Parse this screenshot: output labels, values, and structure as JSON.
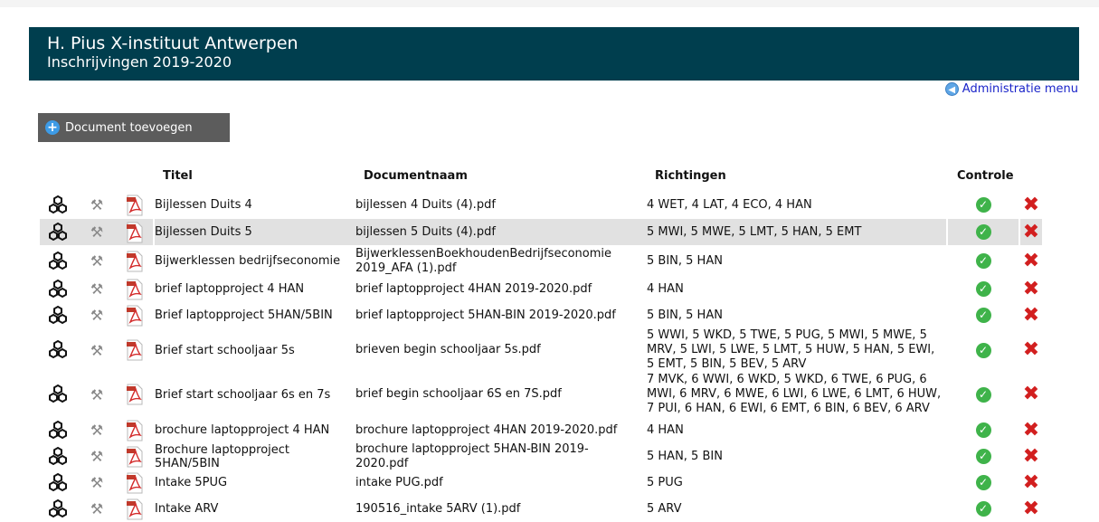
{
  "header": {
    "title": "H. Pius X-instituut Antwerpen",
    "subtitle": "Inschrijvingen 2019-2020"
  },
  "admin_link": "Administratie menu",
  "add_button": "Document toevoegen",
  "columns": {
    "titel": "Titel",
    "documentnaam": "Documentnaam",
    "richtingen": "Richtingen",
    "controle": "Controle"
  },
  "icons": {
    "group": "hexagon-group-icon",
    "tools": "tools-icon",
    "pdf": "pdf-file-icon",
    "ok": "check-circle-icon",
    "delete": "delete-x-icon"
  },
  "colors": {
    "header_bg": "#003e4e",
    "button_bg": "#5c5c5c",
    "highlight_row": "#e1e1e1",
    "check_green": "#3fb34a",
    "delete_red": "#d21f1f"
  },
  "rows": [
    {
      "titel": "Bijlessen Duits 4",
      "doc": "bijlessen 4 Duits (4).pdf",
      "rich": "4 WET, 4 LAT, 4 ECO, 4 HAN"
    },
    {
      "titel": "Bijlessen Duits 5",
      "doc": "bijlessen 5 Duits (4).pdf",
      "rich": "5 MWI, 5 MWE, 5 LMT, 5 HAN, 5 EMT"
    },
    {
      "titel": "Bijwerklessen bedrijfseconomie",
      "doc": "BijwerklessenBoekhoudenBedrijfseconomie 2019_AFA (1).pdf",
      "rich": "5 BIN, 5 HAN"
    },
    {
      "titel": "brief laptopproject 4 HAN",
      "doc": "brief laptopproject 4HAN 2019-2020.pdf",
      "rich": "4 HAN"
    },
    {
      "titel": "Brief laptopproject 5HAN/5BIN",
      "doc": "brief laptopproject 5HAN-BIN 2019-2020.pdf",
      "rich": "5 BIN, 5 HAN"
    },
    {
      "titel": "Brief start schooljaar 5s",
      "doc": "brieven begin schooljaar 5s.pdf",
      "rich": "5 WWI, 5 WKD, 5 TWE, 5 PUG, 5 MWI, 5 MWE, 5 MRV, 5 LWI, 5 LWE, 5 LMT, 5 HUW, 5 HAN, 5 EWI, 5 EMT, 5 BIN, 5 BEV, 5 ARV"
    },
    {
      "titel": "Brief start schooljaar 6s en 7s",
      "doc": "brief begin schooljaar 6S en 7S.pdf",
      "rich": "7 MVK, 6 WWI, 6 WKD, 5 WKD, 6 TWE, 6 PUG, 6 MWI, 6 MRV, 6 MWE, 6 LWI, 6 LWE, 6 LMT, 6 HUW, 7 PUI, 6 HAN, 6 EWI, 6 EMT, 6 BIN, 6 BEV, 6 ARV"
    },
    {
      "titel": "brochure laptopproject 4 HAN",
      "doc": "brochure laptopproject 4HAN 2019-2020.pdf",
      "rich": "4 HAN"
    },
    {
      "titel": "Brochure laptopproject 5HAN/5BIN",
      "doc": "brochure laptopproject 5HAN-BIN 2019-2020.pdf",
      "rich": "5 HAN, 5 BIN"
    },
    {
      "titel": "Intake 5PUG",
      "doc": "intake PUG.pdf",
      "rich": "5 PUG"
    },
    {
      "titel": "Intake ARV",
      "doc": "190516_intake 5ARV (1).pdf",
      "rich": "5 ARV"
    }
  ]
}
